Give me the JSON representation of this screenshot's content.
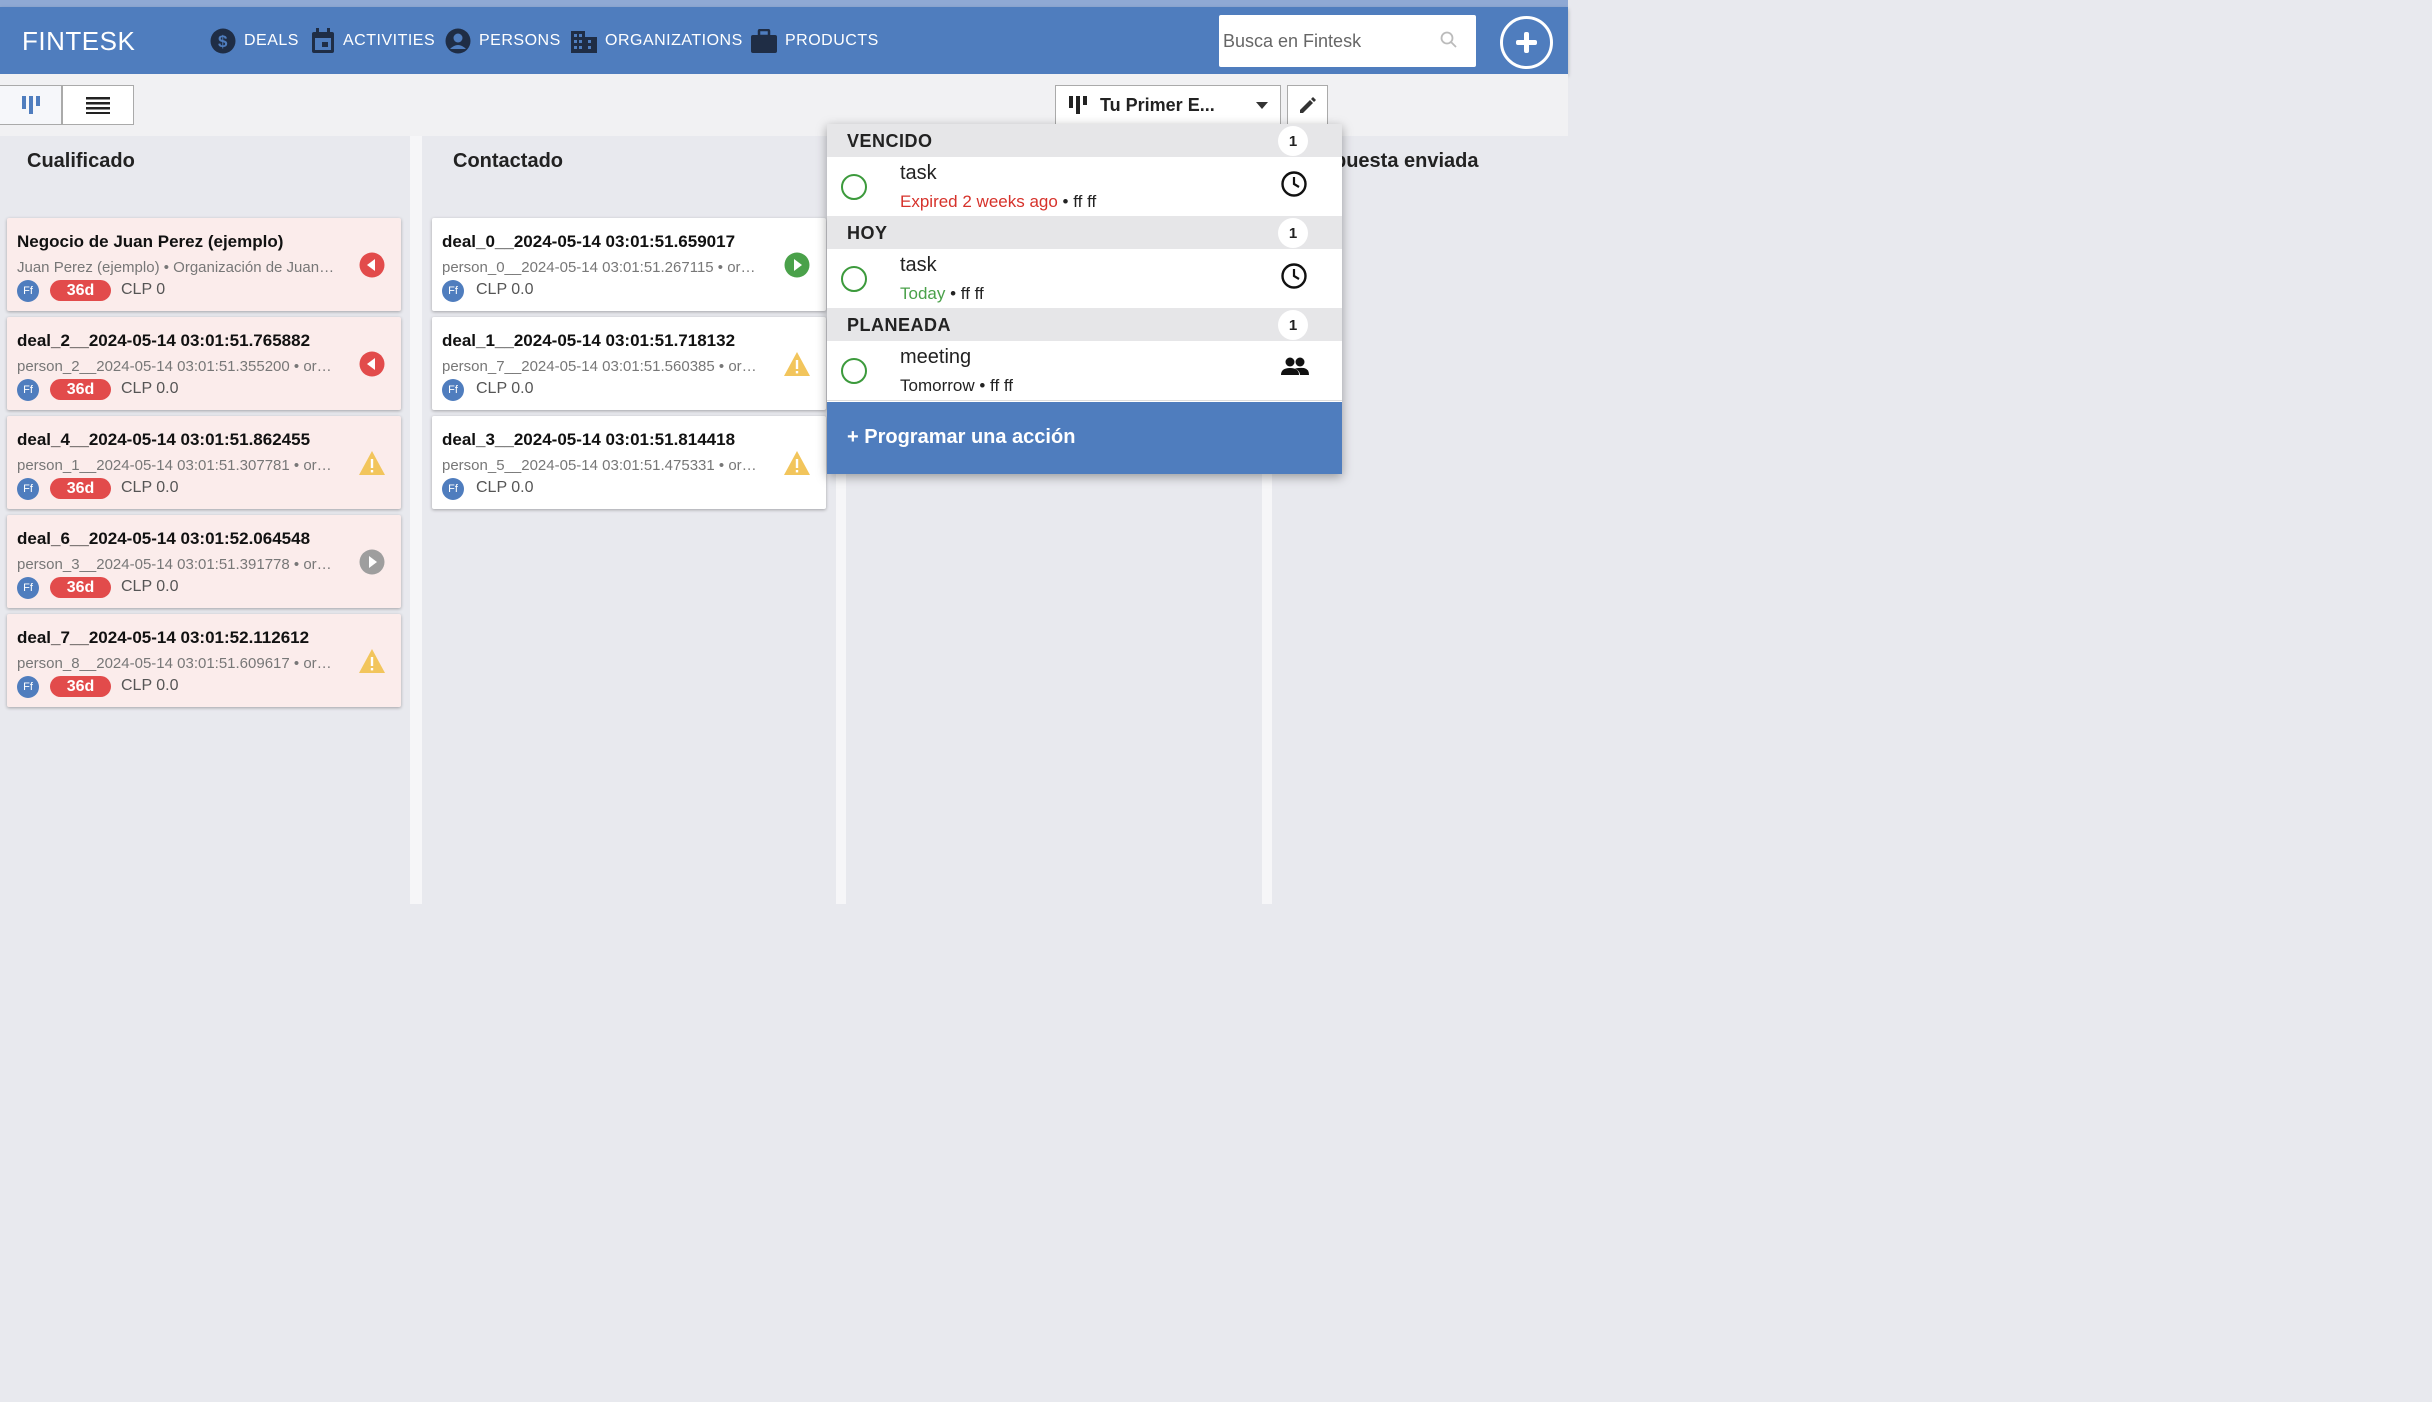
{
  "brand": "FINTESK",
  "nav": {
    "deals": "DEALS",
    "activities": "ACTIVITIES",
    "persons": "PERSONS",
    "organizations": "ORGANIZATIONS",
    "products": "PRODUCTS"
  },
  "search": {
    "placeholder": "Busca en Fintesk"
  },
  "pipeline": {
    "selected": "Tu Primer E..."
  },
  "columns": {
    "c1": "Cualificado",
    "c2": "Contactado",
    "c4": "puesta enviada"
  },
  "deals": [
    {
      "title": "Negocio de Juan Perez (ejemplo)",
      "sub": "Juan Perez (ejemplo) • Organización de Juan…",
      "avatar": "Ff",
      "badge": "36d",
      "amount": "CLP 0",
      "status": "overdue-icon"
    },
    {
      "title": "deal_2__2024-05-14 03:01:51.765882",
      "sub": "person_2__2024-05-14 03:01:51.355200 • or…",
      "avatar": "Ff",
      "badge": "36d",
      "amount": "CLP 0.0",
      "status": "overdue-icon"
    },
    {
      "title": "deal_4__2024-05-14 03:01:51.862455",
      "sub": "person_1__2024-05-14 03:01:51.307781 • or…",
      "avatar": "Ff",
      "badge": "36d",
      "amount": "CLP 0.0",
      "status": "warning-icon"
    },
    {
      "title": "deal_6__2024-05-14 03:01:52.064548",
      "sub": "person_3__2024-05-14 03:01:51.391778 • or…",
      "avatar": "Ff",
      "badge": "36d",
      "amount": "CLP 0.0",
      "status": "planned-icon"
    },
    {
      "title": "deal_7__2024-05-14 03:01:52.112612",
      "sub": "person_8__2024-05-14 03:01:51.609617 • or…",
      "avatar": "Ff",
      "badge": "36d",
      "amount": "CLP 0.0",
      "status": "warning-icon"
    },
    {
      "title": "deal_0__2024-05-14 03:01:51.659017",
      "sub": "person_0__2024-05-14 03:01:51.267115 • or…",
      "avatar": "Ff",
      "amount": "CLP 0.0",
      "status": "today-icon"
    },
    {
      "title": "deal_1__2024-05-14 03:01:51.718132",
      "sub": "person_7__2024-05-14 03:01:51.560385 • or…",
      "avatar": "Ff",
      "amount": "CLP 0.0",
      "status": "warning-icon"
    },
    {
      "title": "deal_3__2024-05-14 03:01:51.814418",
      "sub": "person_5__2024-05-14 03:01:51.475331 • or…",
      "avatar": "Ff",
      "amount": "CLP 0.0",
      "status": "warning-icon"
    }
  ],
  "popup": {
    "sections": [
      {
        "label": "VENCIDO",
        "count": "1",
        "activity": {
          "name": "task",
          "when": "Expired 2 weeks ago",
          "who": " • ff ff",
          "icon": "clock-icon"
        }
      },
      {
        "label": "HOY",
        "count": "1",
        "activity": {
          "name": "task",
          "when": "Today",
          "who": " • ff ff",
          "icon": "clock-icon"
        }
      },
      {
        "label": "PLANEADA",
        "count": "1",
        "activity": {
          "name": "meeting",
          "when": "Tomorrow",
          "who": " • ff ff",
          "icon": "people-icon"
        }
      }
    ],
    "schedule": "+ Programar una acción"
  },
  "colors": {
    "primary": "#4f7dbe",
    "rotten_bg": "#fbeceb",
    "badge_red": "#e24b4b",
    "overdue_red": "#d6322b",
    "success_green": "#4aa14a",
    "warning_yellow": "#f2c55c",
    "neutral_gray": "#9e9e9e"
  }
}
